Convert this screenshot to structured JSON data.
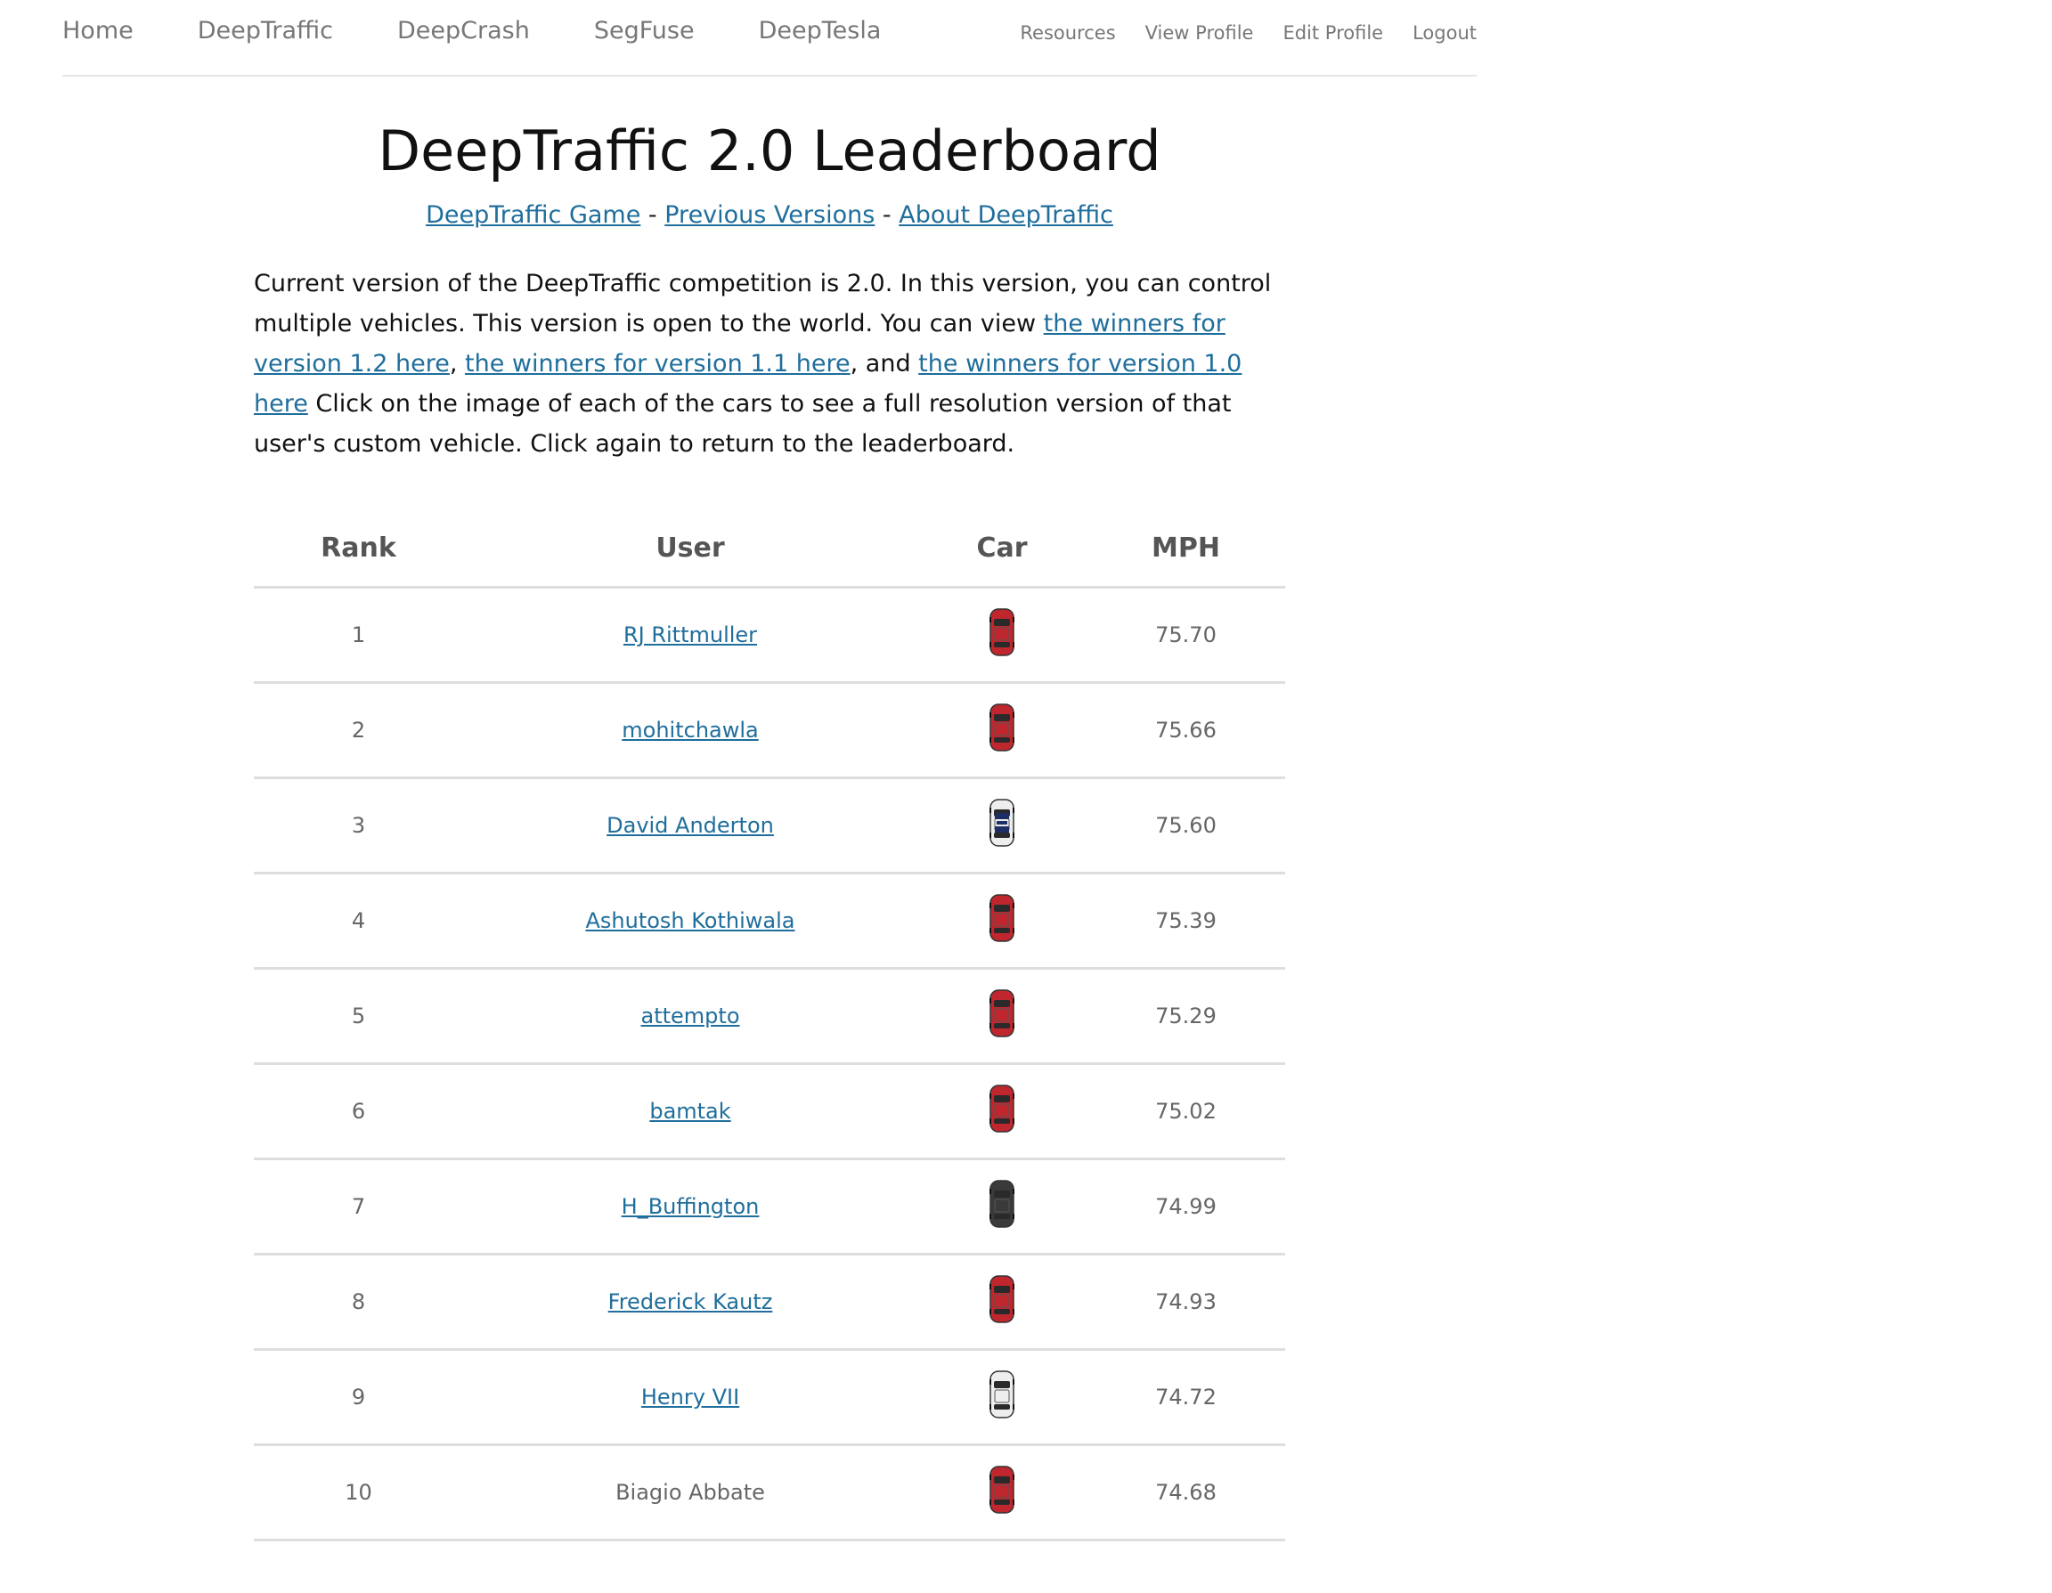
{
  "nav": {
    "left": [
      "Home",
      "DeepTraffic",
      "DeepCrash",
      "SegFuse",
      "DeepTesla"
    ],
    "right": [
      "Resources",
      "View Profile",
      "Edit Profile",
      "Logout"
    ]
  },
  "header": {
    "title": "DeepTraffic 2.0 Leaderboard",
    "links": [
      "DeepTraffic Game",
      "Previous Versions",
      "About DeepTraffic"
    ],
    "separator": " - "
  },
  "intro": {
    "text_1": "Current version of the DeepTraffic competition is 2.0. In this version, you can control multiple vehicles. This version is open to the world. You can view ",
    "link_1": "the winners for version 1.2 here",
    "text_2": ", ",
    "link_2": "the winners for version 1.1 here",
    "text_3": ", and ",
    "link_3": "the winners for version 1.0 here",
    "text_4": " Click on the image of each of the cars to see a full resolution version of that user's custom vehicle. Click again to return to the leaderboard."
  },
  "table": {
    "headers": [
      "Rank",
      "User",
      "Car",
      "MPH"
    ],
    "rows": [
      {
        "rank": "1",
        "user": "RJ Rittmuller",
        "link": true,
        "car": "red-car-icon",
        "mph": "75.70"
      },
      {
        "rank": "2",
        "user": "mohitchawla",
        "link": true,
        "car": "red-car-icon",
        "mph": "75.66"
      },
      {
        "rank": "3",
        "user": "David Anderton",
        "link": true,
        "car": "police-car-icon",
        "mph": "75.60"
      },
      {
        "rank": "4",
        "user": "Ashutosh Kothiwala",
        "link": true,
        "car": "red-car-icon",
        "mph": "75.39"
      },
      {
        "rank": "5",
        "user": "attempto",
        "link": true,
        "car": "red-car-icon",
        "mph": "75.29"
      },
      {
        "rank": "6",
        "user": "bamtak",
        "link": true,
        "car": "red-car-icon",
        "mph": "75.02"
      },
      {
        "rank": "7",
        "user": "H_Buffington",
        "link": true,
        "car": "black-car-icon",
        "mph": "74.99"
      },
      {
        "rank": "8",
        "user": "Frederick Kautz",
        "link": true,
        "car": "red-car-icon",
        "mph": "74.93"
      },
      {
        "rank": "9",
        "user": "Henry VII",
        "link": true,
        "car": "white-car-icon",
        "mph": "74.72"
      },
      {
        "rank": "10",
        "user": "Biagio Abbate",
        "link": false,
        "car": "red-car-icon",
        "mph": "74.68"
      }
    ]
  },
  "colors": {
    "link": "#1f6e9c",
    "nav_text": "#777777",
    "divider": "#dedede",
    "car_red": "#c0262d",
    "car_black": "#3a3a3a",
    "car_white": "#eeeeee",
    "car_police": "#1e2f66"
  }
}
